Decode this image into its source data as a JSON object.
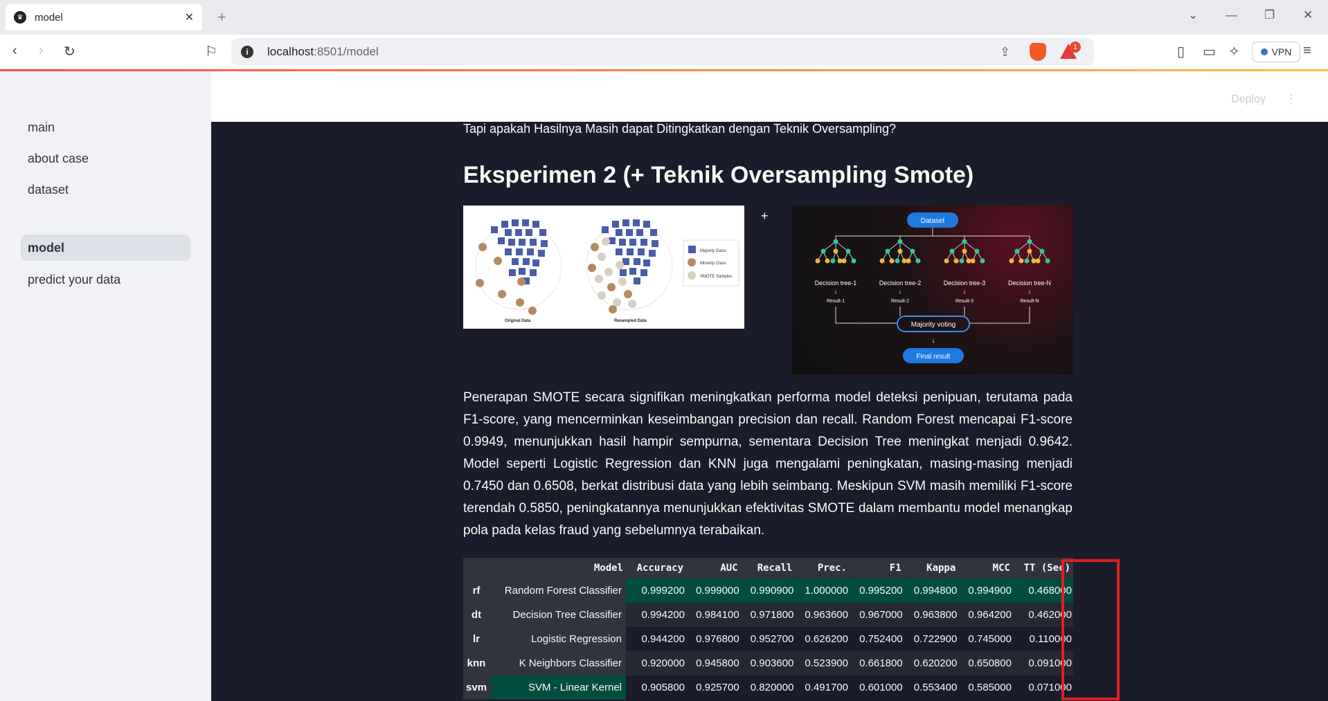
{
  "browser": {
    "tab_title": "model",
    "url_host": "localhost",
    "url_rest": ":8501/model",
    "vpn_label": "VPN",
    "rewards_badge": "1"
  },
  "app": {
    "deploy_label": "Deploy"
  },
  "sidebar": {
    "items": [
      {
        "label": "main"
      },
      {
        "label": "about case"
      },
      {
        "label": "dataset"
      },
      {
        "label": "model"
      },
      {
        "label": "predict your data"
      }
    ]
  },
  "content": {
    "intro_question": "Tapi apakah Hasilnya Masih dapat Ditingkatkan dengan Teknik Oversampling?",
    "heading": "Eksperimen 2 (+ Teknik Oversampling Smote)",
    "plus_sign": "+",
    "smote_image": {
      "legend": [
        "Majority Class",
        "Minority Class",
        "SMOTE Samples"
      ],
      "captions": [
        "Original Data",
        "Resampled Data"
      ]
    },
    "rf_image": {
      "dataset": "Dataset",
      "trees": [
        "Decision tree-1",
        "Decision tree-2",
        "Decision tree-3",
        "Decision tree-N"
      ],
      "results": [
        "Result-1",
        "Result-2",
        "Result-3",
        "Result-N"
      ],
      "voting": "Majority voting",
      "final": "Final result"
    },
    "paragraph": "Penerapan SMOTE secara signifikan meningkatkan performa model deteksi penipuan, terutama pada F1-score, yang mencerminkan keseimbangan precision dan recall. Random Forest mencapai F1-score 0.9949, menunjukkan hasil hampir sempurna, sementara Decision Tree meningkat menjadi 0.9642. Model seperti Logistic Regression dan KNN juga mengalami peningkatan, masing-masing menjadi 0.7450 dan 0.6508, berkat distribusi data yang lebih seimbang. Meskipun SVM masih memiliki F1-score terendah 0.5850, peningkatannya menunjukkan efektivitas SMOTE dalam membantu model menangkap pola pada kelas fraud yang sebelumnya terabaikan."
  },
  "table": {
    "headers": [
      "",
      "Model",
      "Accuracy",
      "AUC",
      "Recall",
      "Prec.",
      "F1",
      "Kappa",
      "MCC",
      "TT (Sec)"
    ],
    "rows": [
      {
        "idx": "rf",
        "model": "Random Forest Classifier",
        "values": [
          "0.999200",
          "0.999000",
          "0.990900",
          "1.000000",
          "0.995200",
          "0.994800",
          "0.994900",
          "0.468000"
        ]
      },
      {
        "idx": "dt",
        "model": "Decision Tree Classifier",
        "values": [
          "0.994200",
          "0.984100",
          "0.971800",
          "0.963600",
          "0.967000",
          "0.963800",
          "0.964200",
          "0.462000"
        ]
      },
      {
        "idx": "lr",
        "model": "Logistic Regression",
        "values": [
          "0.944200",
          "0.976800",
          "0.952700",
          "0.626200",
          "0.752400",
          "0.722900",
          "0.745000",
          "0.110000"
        ]
      },
      {
        "idx": "knn",
        "model": "K Neighbors Classifier",
        "values": [
          "0.920000",
          "0.945800",
          "0.903600",
          "0.523900",
          "0.661800",
          "0.620200",
          "0.650800",
          "0.091000"
        ]
      },
      {
        "idx": "svm",
        "model": "SVM - Linear Kernel",
        "values": [
          "0.905800",
          "0.925700",
          "0.820000",
          "0.491700",
          "0.601000",
          "0.553400",
          "0.585000",
          "0.071000"
        ]
      }
    ],
    "highlight_color": "#004d40"
  }
}
